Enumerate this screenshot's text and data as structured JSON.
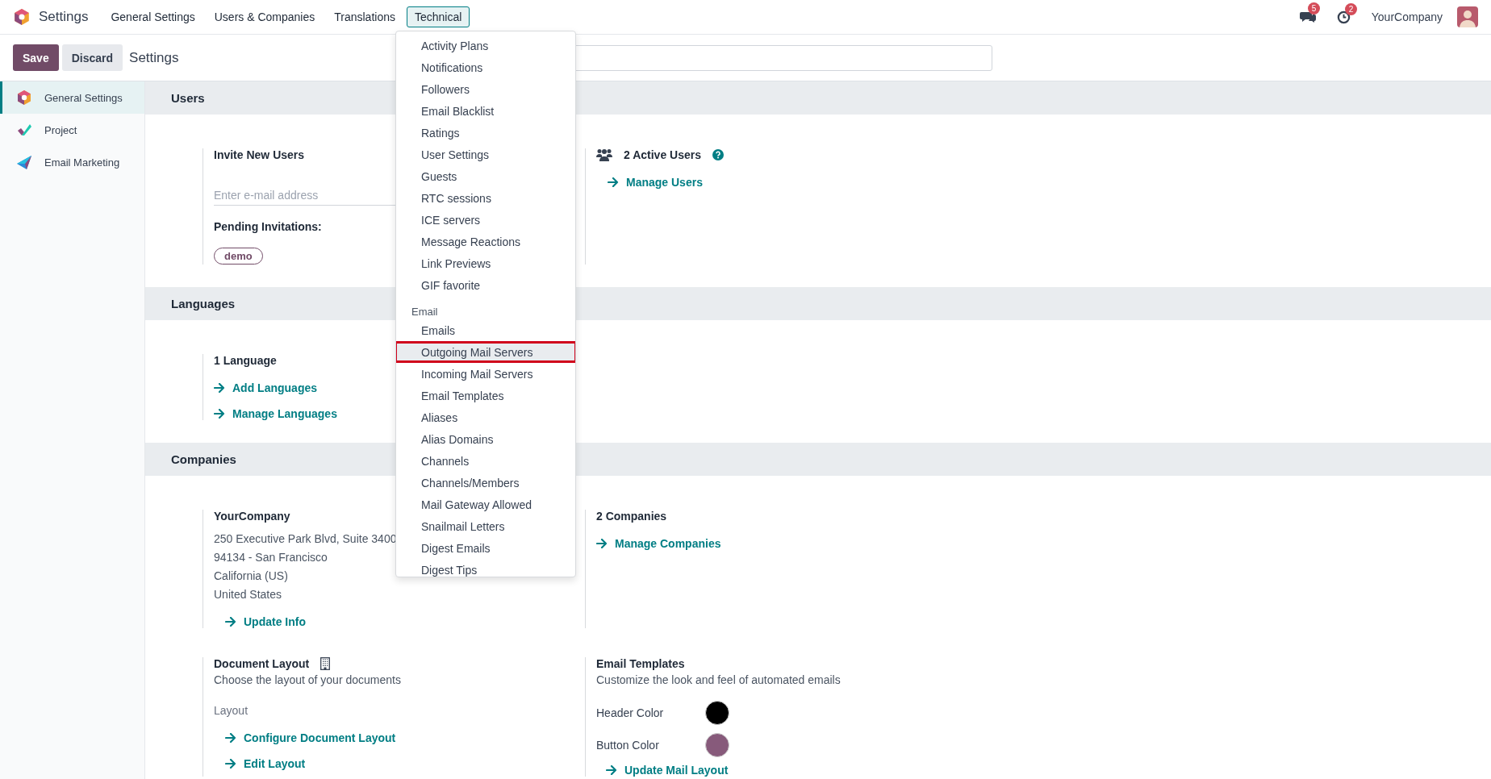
{
  "navbar": {
    "app_title": "Settings",
    "menus": [
      {
        "label": "General Settings",
        "selected": false
      },
      {
        "label": "Users & Companies",
        "selected": false
      },
      {
        "label": "Translations",
        "selected": false
      },
      {
        "label": "Technical",
        "selected": true
      }
    ],
    "messages_badge": "5",
    "activities_badge": "2",
    "company": "YourCompany"
  },
  "control_panel": {
    "save": "Save",
    "discard": "Discard",
    "breadcrumb": "Settings"
  },
  "sidebar": {
    "items": [
      {
        "label": "General Settings",
        "selected": true
      },
      {
        "label": "Project",
        "selected": false
      },
      {
        "label": "Email Marketing",
        "selected": false
      }
    ]
  },
  "sections": [
    {
      "title": "Users",
      "blocks": [
        {
          "kind": "invite",
          "title": "Invite New Users",
          "placeholder": "Enter e-mail address",
          "pending_label": "Pending Invitations:",
          "pending": [
            "demo"
          ]
        },
        {
          "kind": "active_users",
          "title": "2 Active Users",
          "help": true,
          "links": [
            "Manage Users"
          ]
        }
      ]
    },
    {
      "title": "Languages",
      "blocks": [
        {
          "kind": "stat",
          "title": "1 Language",
          "links": [
            "Add Languages",
            "Manage Languages"
          ]
        }
      ]
    },
    {
      "title": "Companies",
      "blocks": [
        {
          "kind": "company",
          "title": "YourCompany",
          "address": [
            "250 Executive Park Blvd, Suite 3400",
            "94134 - San Francisco",
            "California (US)",
            "United States"
          ],
          "links": [
            "Update Info"
          ]
        },
        {
          "kind": "stat",
          "title": "2 Companies",
          "links": [
            "Manage Companies"
          ]
        },
        {
          "kind": "layout",
          "title": "Document Layout",
          "description": "Choose the layout of your documents",
          "sublabel": "Layout",
          "links": [
            "Configure Document Layout",
            "Edit Layout"
          ]
        },
        {
          "kind": "colors",
          "title": "Email Templates",
          "description": "Customize the look and feel of automated emails",
          "colors": [
            {
              "label": "Header Color",
              "color": "#000000"
            },
            {
              "label": "Button Color",
              "color": "#875a7b"
            }
          ],
          "links": [
            "Update Mail Layout"
          ]
        }
      ]
    }
  ],
  "technical_menu": {
    "items": [
      {
        "kind": "item",
        "label": "Activity Plans",
        "selected": false
      },
      {
        "kind": "item",
        "label": "Notifications",
        "selected": false
      },
      {
        "kind": "item",
        "label": "Followers",
        "selected": false
      },
      {
        "kind": "item",
        "label": "Email Blacklist",
        "selected": false
      },
      {
        "kind": "item",
        "label": "Ratings",
        "selected": false
      },
      {
        "kind": "item",
        "label": "User Settings",
        "selected": false
      },
      {
        "kind": "item",
        "label": "Guests",
        "selected": false
      },
      {
        "kind": "item",
        "label": "RTC sessions",
        "selected": false
      },
      {
        "kind": "item",
        "label": "ICE servers",
        "selected": false
      },
      {
        "kind": "item",
        "label": "Message Reactions",
        "selected": false
      },
      {
        "kind": "item",
        "label": "Link Previews",
        "selected": false
      },
      {
        "kind": "item",
        "label": "GIF favorite",
        "selected": false
      },
      {
        "kind": "header",
        "label": "Email"
      },
      {
        "kind": "item",
        "label": "Emails",
        "selected": false
      },
      {
        "kind": "item",
        "label": "Outgoing Mail Servers",
        "selected": true
      },
      {
        "kind": "item",
        "label": "Incoming Mail Servers",
        "selected": false
      },
      {
        "kind": "item",
        "label": "Email Templates",
        "selected": false
      },
      {
        "kind": "item",
        "label": "Aliases",
        "selected": false
      },
      {
        "kind": "item",
        "label": "Alias Domains",
        "selected": false
      },
      {
        "kind": "item",
        "label": "Channels",
        "selected": false
      },
      {
        "kind": "item",
        "label": "Channels/Members",
        "selected": false
      },
      {
        "kind": "item",
        "label": "Mail Gateway Allowed",
        "selected": false
      },
      {
        "kind": "item",
        "label": "Snailmail Letters",
        "selected": false
      },
      {
        "kind": "item",
        "label": "Digest Emails",
        "selected": false
      },
      {
        "kind": "item",
        "label": "Digest Tips",
        "selected": false
      }
    ]
  }
}
